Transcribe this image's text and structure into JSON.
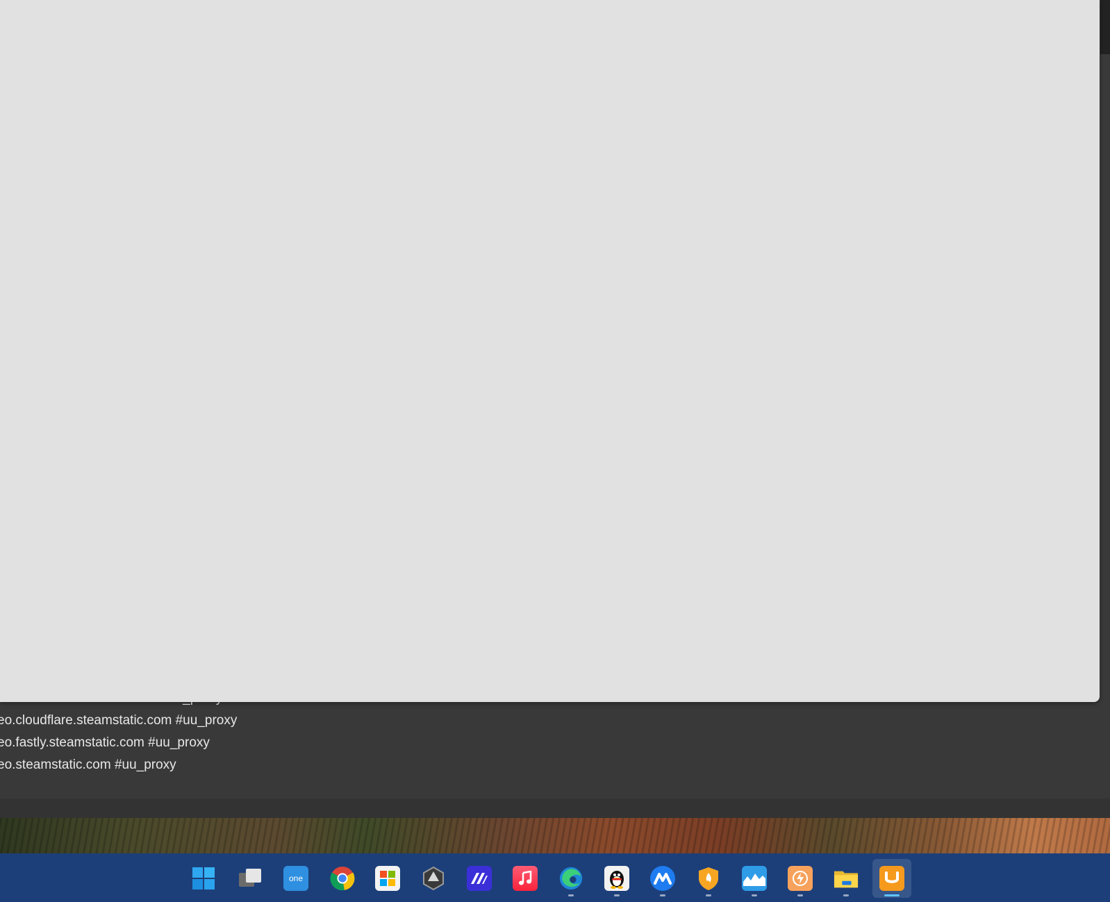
{
  "editor": {
    "lines": [
      "eo.akamai.steamstatic.com #uu_proxy",
      "eo.cloudflare.steamstatic.com #uu_proxy",
      "eo.fastly.steamstatic.com #uu_proxy",
      "eo.steamstatic.com #uu_proxy"
    ]
  },
  "taskbar": {
    "items": [
      {
        "icon": "windows-start-icon"
      },
      {
        "icon": "task-view-icon"
      },
      {
        "icon": "onenote-icon",
        "text": "one"
      },
      {
        "icon": "chrome-icon"
      },
      {
        "icon": "microsoft-store-icon"
      },
      {
        "icon": "app-hexagon-icon"
      },
      {
        "icon": "app-stripes-icon"
      },
      {
        "icon": "music-icon"
      },
      {
        "icon": "edge-icon",
        "running": true
      },
      {
        "icon": "qq-penguin-icon",
        "running": true
      },
      {
        "icon": "meeting-icon",
        "running": true
      },
      {
        "icon": "shield-flame-icon",
        "running": true
      },
      {
        "icon": "monitor-wave-icon",
        "running": true
      },
      {
        "icon": "bolt-app-icon",
        "running": true
      },
      {
        "icon": "file-explorer-icon",
        "running": true
      },
      {
        "icon": "uu-booster-icon",
        "running": true,
        "active": true
      }
    ]
  }
}
